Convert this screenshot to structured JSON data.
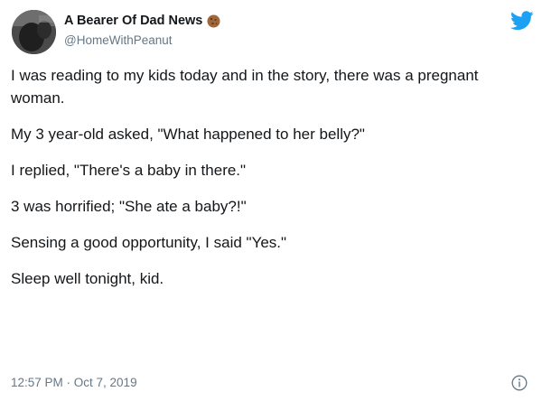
{
  "author": {
    "display_name": "A Bearer Of Dad News",
    "handle": "@HomeWithPeanut",
    "badge_icon": "cookie-icon",
    "avatar_icon": "avatar"
  },
  "brand": {
    "icon": "twitter-bird-icon",
    "color": "#1da1f2"
  },
  "tweet": {
    "paragraphs": [
      "I was reading to my kids today and in the story, there was a pregnant woman.",
      "My 3 year-old asked, \"What happened to her belly?\"",
      "I replied, \"There's a baby in there.\"",
      "3 was horrified; \"She ate a baby?!\"",
      "Sensing a good opportunity, I said \"Yes.\"",
      "Sleep well tonight, kid."
    ],
    "timestamp": "12:57 PM · Oct 7, 2019"
  },
  "footer": {
    "info_icon": "info-icon"
  },
  "colors": {
    "text": "#14171a",
    "muted": "#657786"
  }
}
